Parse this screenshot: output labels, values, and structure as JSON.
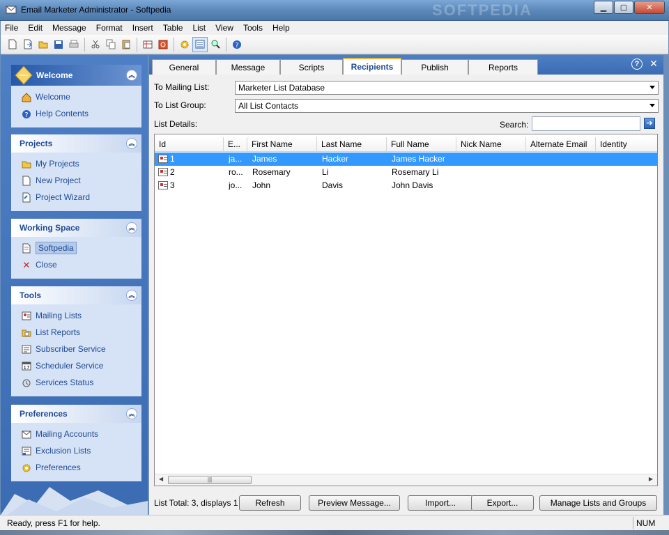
{
  "window": {
    "title": "Email Marketer Administrator - Softpedia",
    "watermark": "SOFTPEDIA"
  },
  "menu": [
    "File",
    "Edit",
    "Message",
    "Format",
    "Insert",
    "Table",
    "List",
    "View",
    "Tools",
    "Help"
  ],
  "left_panel": {
    "welcome": {
      "title": "Welcome",
      "items": [
        "Welcome",
        "Help Contents"
      ]
    },
    "projects": {
      "title": "Projects",
      "items": [
        "My Projects",
        "New Project",
        "Project Wizard"
      ]
    },
    "working_space": {
      "title": "Working Space",
      "items": [
        "Softpedia",
        "Close"
      ]
    },
    "tools": {
      "title": "Tools",
      "items": [
        "Mailing Lists",
        "List Reports",
        "Subscriber Service",
        "Scheduler Service",
        "Services Status"
      ]
    },
    "preferences": {
      "title": "Preferences",
      "items": [
        "Mailing Accounts",
        "Exclusion Lists",
        "Preferences"
      ]
    }
  },
  "tabs": [
    "General",
    "Message",
    "Scripts",
    "Recipients",
    "Publish",
    "Reports"
  ],
  "active_tab": "Recipients",
  "form": {
    "mailing_list_label": "To Mailing List:",
    "mailing_list_value": "Marketer List Database",
    "list_group_label": "To List Group:",
    "list_group_value": "All List Contacts",
    "list_details_label": "List Details:",
    "search_label": "Search:",
    "search_value": ""
  },
  "grid": {
    "columns": [
      "Id",
      "E...",
      "First Name",
      "Last Name",
      "Full Name",
      "Nick Name",
      "Alternate Email",
      "Identity"
    ],
    "rows": [
      {
        "id": "1",
        "email": "ja...",
        "first": "James",
        "last": "Hacker",
        "full": "James Hacker"
      },
      {
        "id": "2",
        "email": "ro...",
        "first": "Rosemary",
        "last": "Li",
        "full": "Rosemary Li"
      },
      {
        "id": "3",
        "email": "jo...",
        "first": "John",
        "last": "Davis",
        "full": "John Davis"
      }
    ],
    "selected_row": 0
  },
  "footer": {
    "list_total": "List Total: 3, displays 1",
    "buttons": [
      "Refresh",
      "Preview Message...",
      "Import...",
      "Export...",
      "Manage Lists and Groups"
    ]
  },
  "status": {
    "text": "Ready, press F1 for help.",
    "num": "NUM"
  },
  "colors": {
    "accent": "#3b6bb2",
    "selection": "#3399ff",
    "tab_highlight": "#f2b33d"
  }
}
